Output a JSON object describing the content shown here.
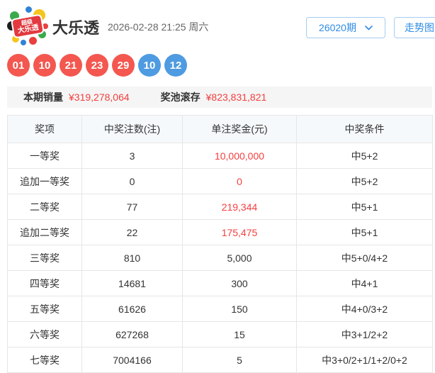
{
  "header": {
    "logo_line1": "超级",
    "logo_line2": "大乐透",
    "title": "大乐透",
    "datetime": "2026-02-28 21:25 周六",
    "period_select_label": "26020期",
    "trend_button_label": "走势图"
  },
  "draw": {
    "front_numbers": [
      "01",
      "10",
      "21",
      "23",
      "29"
    ],
    "back_numbers": [
      "10",
      "12"
    ]
  },
  "sales": {
    "sales_label": "本期销量",
    "sales_value": "¥319,278,064",
    "pool_label": "奖池滚存",
    "pool_value": "¥823,831,821"
  },
  "prize_table": {
    "headers": [
      "奖项",
      "中奖注数(注)",
      "单注奖金(元)",
      "中奖条件"
    ],
    "rows": [
      {
        "level": "一等奖",
        "count": "3",
        "prize": "10,000,000",
        "prize_red": true,
        "condition": "中5+2"
      },
      {
        "level": "追加一等奖",
        "count": "0",
        "prize": "0",
        "prize_red": true,
        "condition": "中5+2"
      },
      {
        "level": "二等奖",
        "count": "77",
        "prize": "219,344",
        "prize_red": true,
        "condition": "中5+1"
      },
      {
        "level": "追加二等奖",
        "count": "22",
        "prize": "175,475",
        "prize_red": true,
        "condition": "中5+1"
      },
      {
        "level": "三等奖",
        "count": "810",
        "prize": "5,000",
        "prize_red": false,
        "condition": "中5+0/4+2"
      },
      {
        "level": "四等奖",
        "count": "14681",
        "prize": "300",
        "prize_red": false,
        "condition": "中4+1"
      },
      {
        "level": "五等奖",
        "count": "61626",
        "prize": "150",
        "prize_red": false,
        "condition": "中4+0/3+2"
      },
      {
        "level": "六等奖",
        "count": "627268",
        "prize": "15",
        "prize_red": false,
        "condition": "中3+1/2+2"
      },
      {
        "level": "七等奖",
        "count": "7004166",
        "prize": "5",
        "prize_red": false,
        "condition": "中3+0/2+1/1+2/0+2"
      }
    ]
  },
  "colors": {
    "accent_blue": "#2e8ce6",
    "light_blue_border": "#a6cdf0",
    "red_text": "#f43e3e",
    "front_ball_red": "#f3574f",
    "back_ball_blue": "#4e9be1",
    "table_header_bg": "#f6f9fc",
    "sales_bar_bg": "#f5f5f5",
    "border_gray": "#e6e6e6"
  }
}
